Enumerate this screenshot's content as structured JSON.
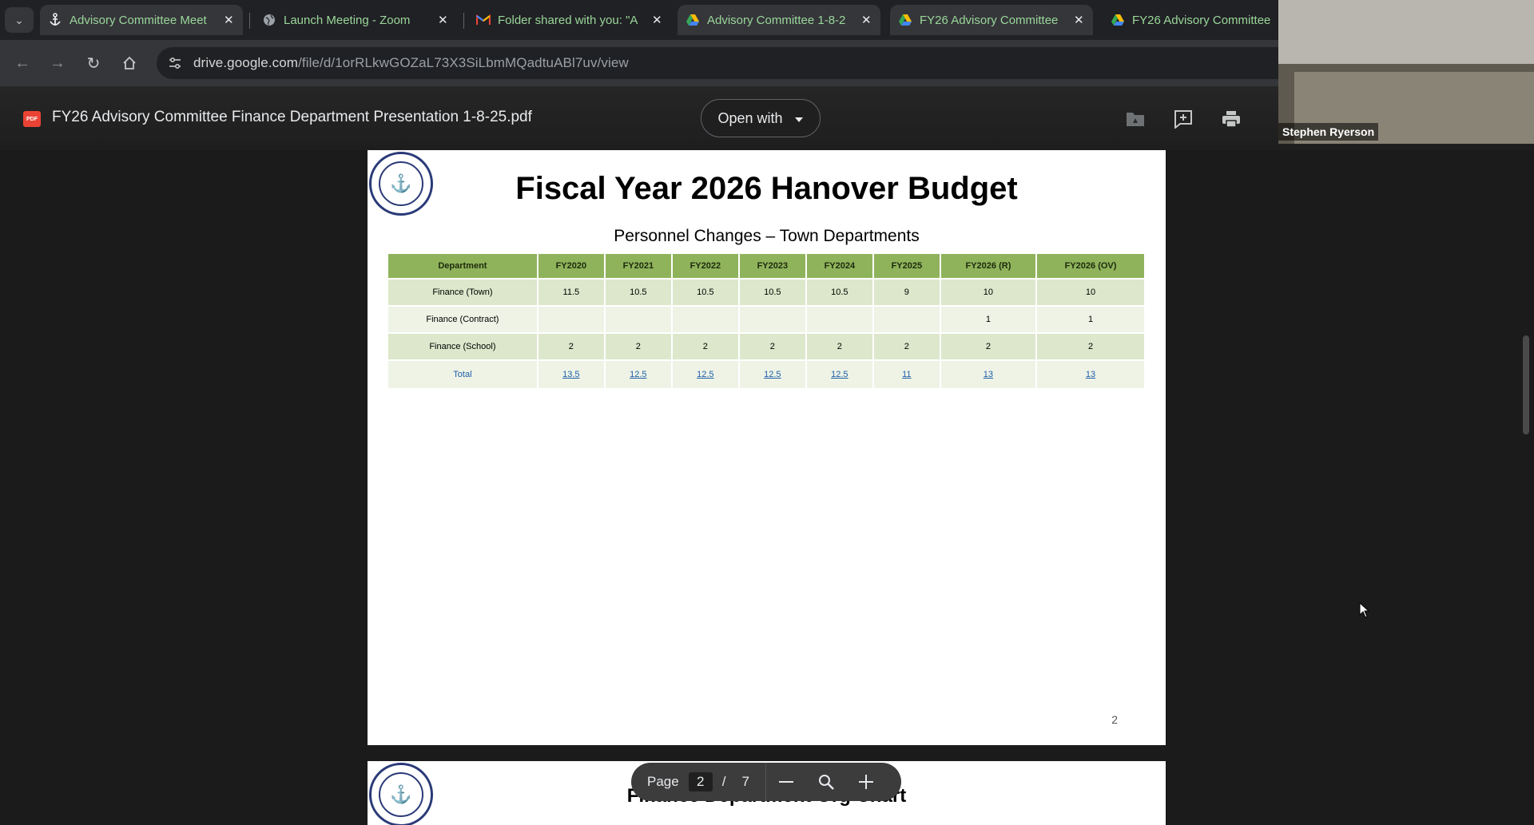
{
  "tabs": [
    {
      "title": "Advisory Committee Meet",
      "icon": "anchor-icon",
      "active": true
    },
    {
      "title": "Launch Meeting - Zoom",
      "icon": "globe-icon",
      "active": false
    },
    {
      "title": "Folder shared with you: \"A",
      "icon": "gmail-icon",
      "active": false
    },
    {
      "title": "Advisory Committee 1-8-2",
      "icon": "drive-icon",
      "active": false
    },
    {
      "title": "FY26 Advisory Committee",
      "icon": "drive-icon",
      "active": true
    },
    {
      "title": "FY26 Advisory Committee",
      "icon": "drive-icon",
      "active": false
    }
  ],
  "address_bar": {
    "host": "drive.google.com",
    "path": "/file/d/1orRLkwGOZaL73X3SiLbmMQadtuABl7uv/view"
  },
  "viewer": {
    "file_title": "FY26 Advisory Committee Finance Department Presentation 1-8-25.pdf",
    "file_type_badge": "PDF",
    "open_with_label": "Open with",
    "header_icons": [
      "add-to-drive-icon",
      "add-comment-icon",
      "print-icon"
    ]
  },
  "page2": {
    "title": "Fiscal Year 2026 Hanover Budget",
    "subtitle": "Personnel Changes – Town Departments",
    "columns": [
      "Department",
      "FY2020",
      "FY2021",
      "FY2022",
      "FY2023",
      "FY2024",
      "FY2025",
      "FY2026 (R)",
      "FY2026 (OV)"
    ],
    "rows": [
      [
        "Finance (Town)",
        "11.5",
        "10.5",
        "10.5",
        "10.5",
        "10.5",
        "9",
        "10",
        "10"
      ],
      [
        "Finance (Contract)",
        "",
        "",
        "",
        "",
        "",
        "",
        "1",
        "1"
      ],
      [
        "Finance (School)",
        "2",
        "2",
        "2",
        "2",
        "2",
        "2",
        "2",
        "2"
      ],
      [
        "Total",
        "13.5",
        "12.5",
        "12.5",
        "12.5",
        "12.5",
        "11",
        "13",
        "13"
      ]
    ],
    "page_number": "2"
  },
  "page3": {
    "title": "Finance Department Org Chart"
  },
  "pager": {
    "label": "Page",
    "current": "2",
    "separator": "/",
    "total": "7"
  },
  "video_overlay": {
    "participant_name": "Stephen Ryerson"
  }
}
